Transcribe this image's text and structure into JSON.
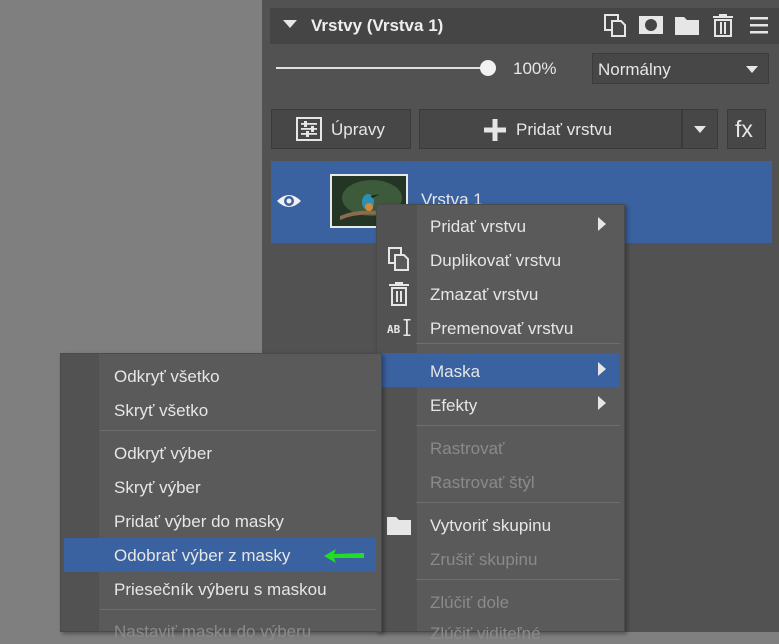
{
  "panel": {
    "title": "Vrstvy (Vrstva 1)",
    "header_icons": [
      "duplicate-icon",
      "mask-icon",
      "folder-icon",
      "trash-icon",
      "menu-icon"
    ],
    "opacity": "100%",
    "opacity_value": 1.0,
    "blend_mode": "Normálny"
  },
  "buttons": {
    "adjustments": "Úpravy",
    "add_layer": "Pridať vrstvu",
    "fx": "fx"
  },
  "layer": {
    "name": "Vrstva 1",
    "visible_icon": "eye-icon"
  },
  "layer_menu": {
    "items": [
      {
        "label": "Pridať vrstvu",
        "submenu": true
      },
      {
        "label": "Duplikovať vrstvu",
        "icon": "duplicate-icon"
      },
      {
        "label": "Zmazať vrstvu",
        "icon": "trash-icon"
      },
      {
        "label": "Premenovať vrstvu",
        "icon": "rename-icon"
      },
      {
        "label": "Maska",
        "submenu": true,
        "highlighted": true
      },
      {
        "label": "Efekty",
        "submenu": true
      },
      {
        "label": "Rastrovať",
        "disabled": true
      },
      {
        "label": "Rastrovať štýl",
        "disabled": true
      },
      {
        "label": "Vytvoriť skupinu",
        "icon": "folder-icon"
      },
      {
        "label": "Zrušiť skupinu",
        "disabled": true
      },
      {
        "label": "Zlúčiť dole",
        "disabled": true
      },
      {
        "label": "Zlúčiť viditeľné",
        "disabled": true
      }
    ]
  },
  "mask_menu": {
    "items": [
      {
        "label": "Odkryť všetko"
      },
      {
        "label": "Skryť všetko"
      },
      {
        "label": "Odkryť výber"
      },
      {
        "label": "Skryť výber"
      },
      {
        "label": "Pridať výber do masky"
      },
      {
        "label": "Odobrať výber z masky",
        "highlighted": true
      },
      {
        "label": "Priesečník výberu s maskou"
      },
      {
        "label": "Nastaviť masku do výberu",
        "disabled": true
      }
    ]
  },
  "colors": {
    "highlight": "#3a61a0",
    "pointer_arrow": "#22dd22"
  }
}
